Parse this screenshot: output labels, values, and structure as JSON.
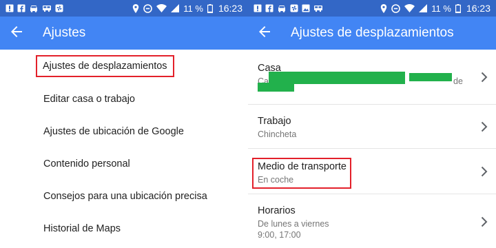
{
  "status": {
    "battery": "11 %",
    "time": "16:23"
  },
  "left": {
    "title": "Ajustes",
    "items": [
      {
        "label": "Ajustes de desplazamientos",
        "highlighted": true
      },
      {
        "label": "Editar casa o trabajo"
      },
      {
        "label": "Ajustes de ubicación de Google"
      },
      {
        "label": "Contenido personal"
      },
      {
        "label": "Consejos para una ubicación precisa"
      },
      {
        "label": "Historial de Maps"
      }
    ]
  },
  "right": {
    "title": "Ajustes de desplazamientos",
    "rows": [
      {
        "title": "Casa",
        "subtitle_start": "Calle",
        "subtitle_end": "de"
      },
      {
        "title": "Trabajo",
        "subtitle": "Chincheta"
      },
      {
        "title": "Medio de transporte",
        "subtitle": "En coche",
        "highlighted": true
      },
      {
        "title": "Horarios",
        "subtitle": "De lunes a viernes",
        "subtitle2": "9:00, 17:00"
      }
    ]
  },
  "colors": {
    "statusbar": "#3367c6",
    "appbar": "#4285f4",
    "highlight": "#e3202a",
    "redaction": "#22b14c"
  }
}
